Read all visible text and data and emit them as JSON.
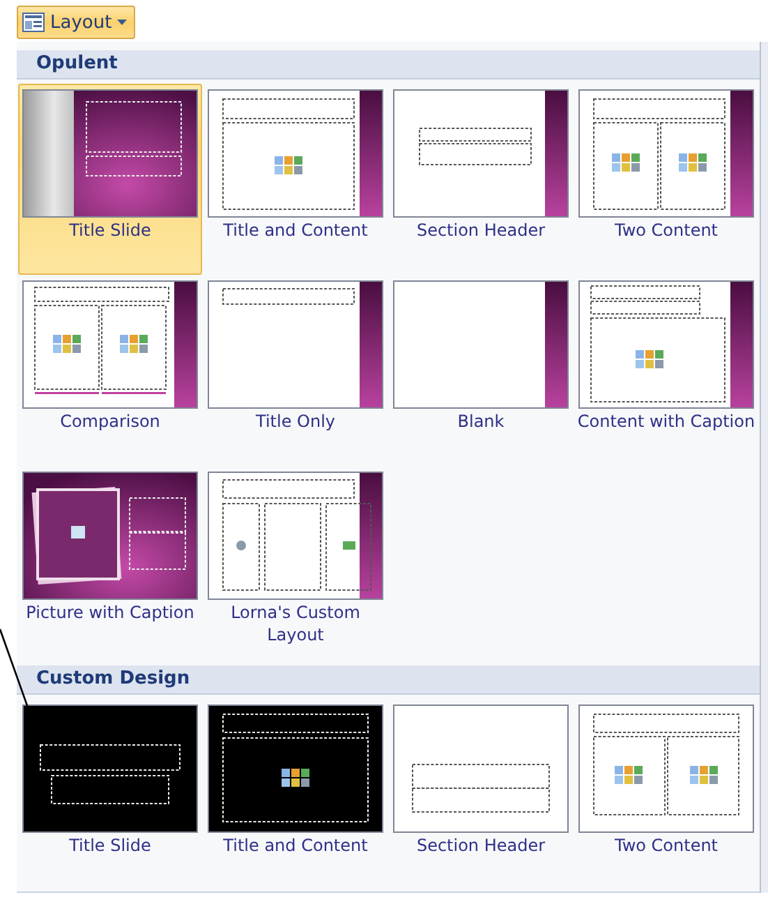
{
  "button": {
    "label": "Layout"
  },
  "sections": [
    {
      "title": "Opulent",
      "kind": "opulent",
      "layouts": [
        {
          "label": "Title Slide",
          "kind": "title-slide",
          "selected": true
        },
        {
          "label": "Title and Content",
          "kind": "title-content",
          "selected": false
        },
        {
          "label": "Section Header",
          "kind": "section-header",
          "selected": false
        },
        {
          "label": "Two Content",
          "kind": "two-content",
          "selected": false
        },
        {
          "label": "Comparison",
          "kind": "comparison",
          "selected": false
        },
        {
          "label": "Title Only",
          "kind": "title-only",
          "selected": false
        },
        {
          "label": "Blank",
          "kind": "blank",
          "selected": false
        },
        {
          "label": "Content with Caption",
          "kind": "content-caption",
          "selected": false
        },
        {
          "label": "Picture with Caption",
          "kind": "picture-caption",
          "selected": false
        },
        {
          "label": "Lorna's Custom Layout",
          "kind": "custom-layout",
          "selected": false
        }
      ]
    },
    {
      "title": "Custom Design",
      "kind": "custom",
      "layouts": [
        {
          "label": "Title Slide",
          "kind": "title-slide",
          "selected": false
        },
        {
          "label": "Title and Content",
          "kind": "title-content",
          "selected": false
        },
        {
          "label": "Section Header",
          "kind": "section-header",
          "selected": false
        },
        {
          "label": "Two Content",
          "kind": "two-content",
          "selected": false
        }
      ]
    }
  ]
}
